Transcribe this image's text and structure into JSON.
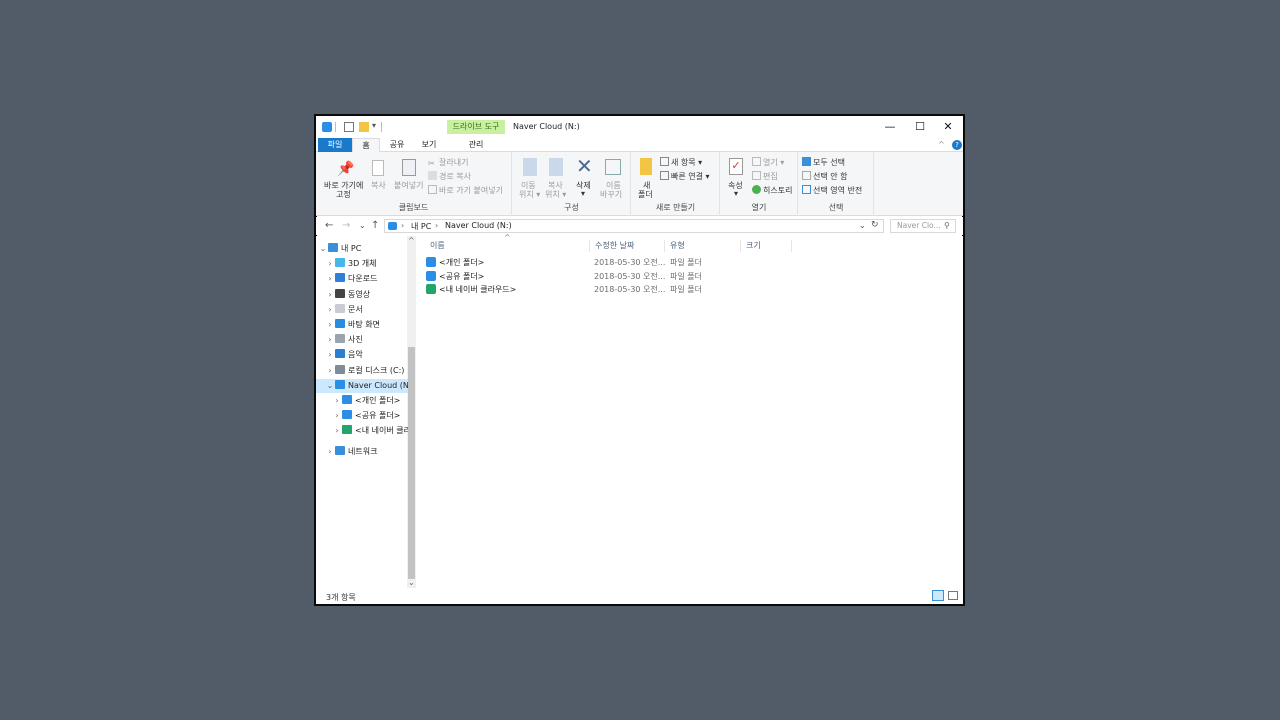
{
  "window": {
    "title": "Naver Cloud (N:)",
    "contextual_tab": "드라이브 도구",
    "controls": {
      "minimize": "—",
      "maximize": "☐",
      "close": "✕"
    }
  },
  "tabs": {
    "file": "파일",
    "home": "홈",
    "share": "공유",
    "view": "보기",
    "manage": "관리"
  },
  "ribbon": {
    "clipboard": {
      "label": "클립보드",
      "pin": "바로 가기에",
      "pin2": "고정",
      "copy": "복사",
      "paste": "붙여넣기",
      "cut": "잘라내기",
      "copy_path": "경로 복사",
      "paste_shortcut": "바로 가기 붙여넣기"
    },
    "organize": {
      "label": "구성",
      "move_to": "이동",
      "move_to2": "위치 ▾",
      "copy_to": "복사",
      "copy_to2": "위치 ▾",
      "delete": "삭제",
      "delete2": "▾",
      "rename": "이름",
      "rename2": "바꾸기"
    },
    "new": {
      "label": "새로 만들기",
      "new_folder": "새",
      "new_folder2": "폴더",
      "new_item": "새 항목 ▾",
      "easy_access": "빠른 연결 ▾"
    },
    "open": {
      "label": "열기",
      "properties": "속성",
      "properties2": "▾",
      "open": "열기 ▾",
      "edit": "편집",
      "history": "히스토리"
    },
    "select": {
      "label": "선택",
      "select_all": "모두 선택",
      "select_none": "선택 안 함",
      "invert": "선택 영역 반전"
    }
  },
  "address": {
    "back": "←",
    "forward": "→",
    "recent": "⌄",
    "up": "↑",
    "path": [
      "내 PC",
      "Naver Cloud (N:)"
    ],
    "sep": "›",
    "search_placeholder": "Naver Clo...",
    "refresh": "↻"
  },
  "nav": [
    {
      "label": "내 PC",
      "chev": "⌄",
      "indent": 0,
      "color": "#3a8fd8"
    },
    {
      "label": "3D 개체",
      "chev": "›",
      "indent": 1,
      "color": "#47b6e8"
    },
    {
      "label": "다운로드",
      "chev": "›",
      "indent": 1,
      "color": "#2f7fd6"
    },
    {
      "label": "동영상",
      "chev": "›",
      "indent": 1,
      "color": "#444444"
    },
    {
      "label": "문서",
      "chev": "›",
      "indent": 1,
      "color": "#c9cdd3"
    },
    {
      "label": "바탕 화면",
      "chev": "›",
      "indent": 1,
      "color": "#2a8ce0"
    },
    {
      "label": "사진",
      "chev": "›",
      "indent": 1,
      "color": "#9aa4ae"
    },
    {
      "label": "음악",
      "chev": "›",
      "indent": 1,
      "color": "#2a7fd0"
    },
    {
      "label": "로컬 디스크 (C:)",
      "chev": "›",
      "indent": 1,
      "color": "#7f8c99"
    },
    {
      "label": "Naver Cloud (N:)",
      "chev": "⌄",
      "indent": 1,
      "color": "#2b8de6",
      "selected": true
    },
    {
      "label": "<개인 폴더>",
      "chev": "›",
      "indent": 2,
      "color": "#2b8de6"
    },
    {
      "label": "<공유 폴더>",
      "chev": "›",
      "indent": 2,
      "color": "#2b8de6"
    },
    {
      "label": "<내 네이버 클라우드>",
      "chev": "›",
      "indent": 2,
      "color": "#21a56b"
    },
    {
      "label": "네트워크",
      "chev": "›",
      "indent": 1,
      "color": "#3a8fd8"
    }
  ],
  "columns": {
    "name": "이름",
    "date": "수정한 날짜",
    "type": "유형",
    "size": "크기"
  },
  "files": [
    {
      "name": "<개인 폴더>",
      "date": "2018-05-30 오전...",
      "type": "파일 폴더",
      "color": "#2b8de6"
    },
    {
      "name": "<공유 폴더>",
      "date": "2018-05-30 오전...",
      "type": "파일 폴더",
      "color": "#2b8de6"
    },
    {
      "name": "<내 네이버 클라우드>",
      "date": "2018-05-30 오전...",
      "type": "파일 폴더",
      "color": "#21a56b"
    }
  ],
  "status": {
    "count": "3개 항목"
  },
  "colors": {
    "accent": "#1979ca",
    "contextual": "#c8f0a0",
    "selection": "#cce8ff"
  }
}
